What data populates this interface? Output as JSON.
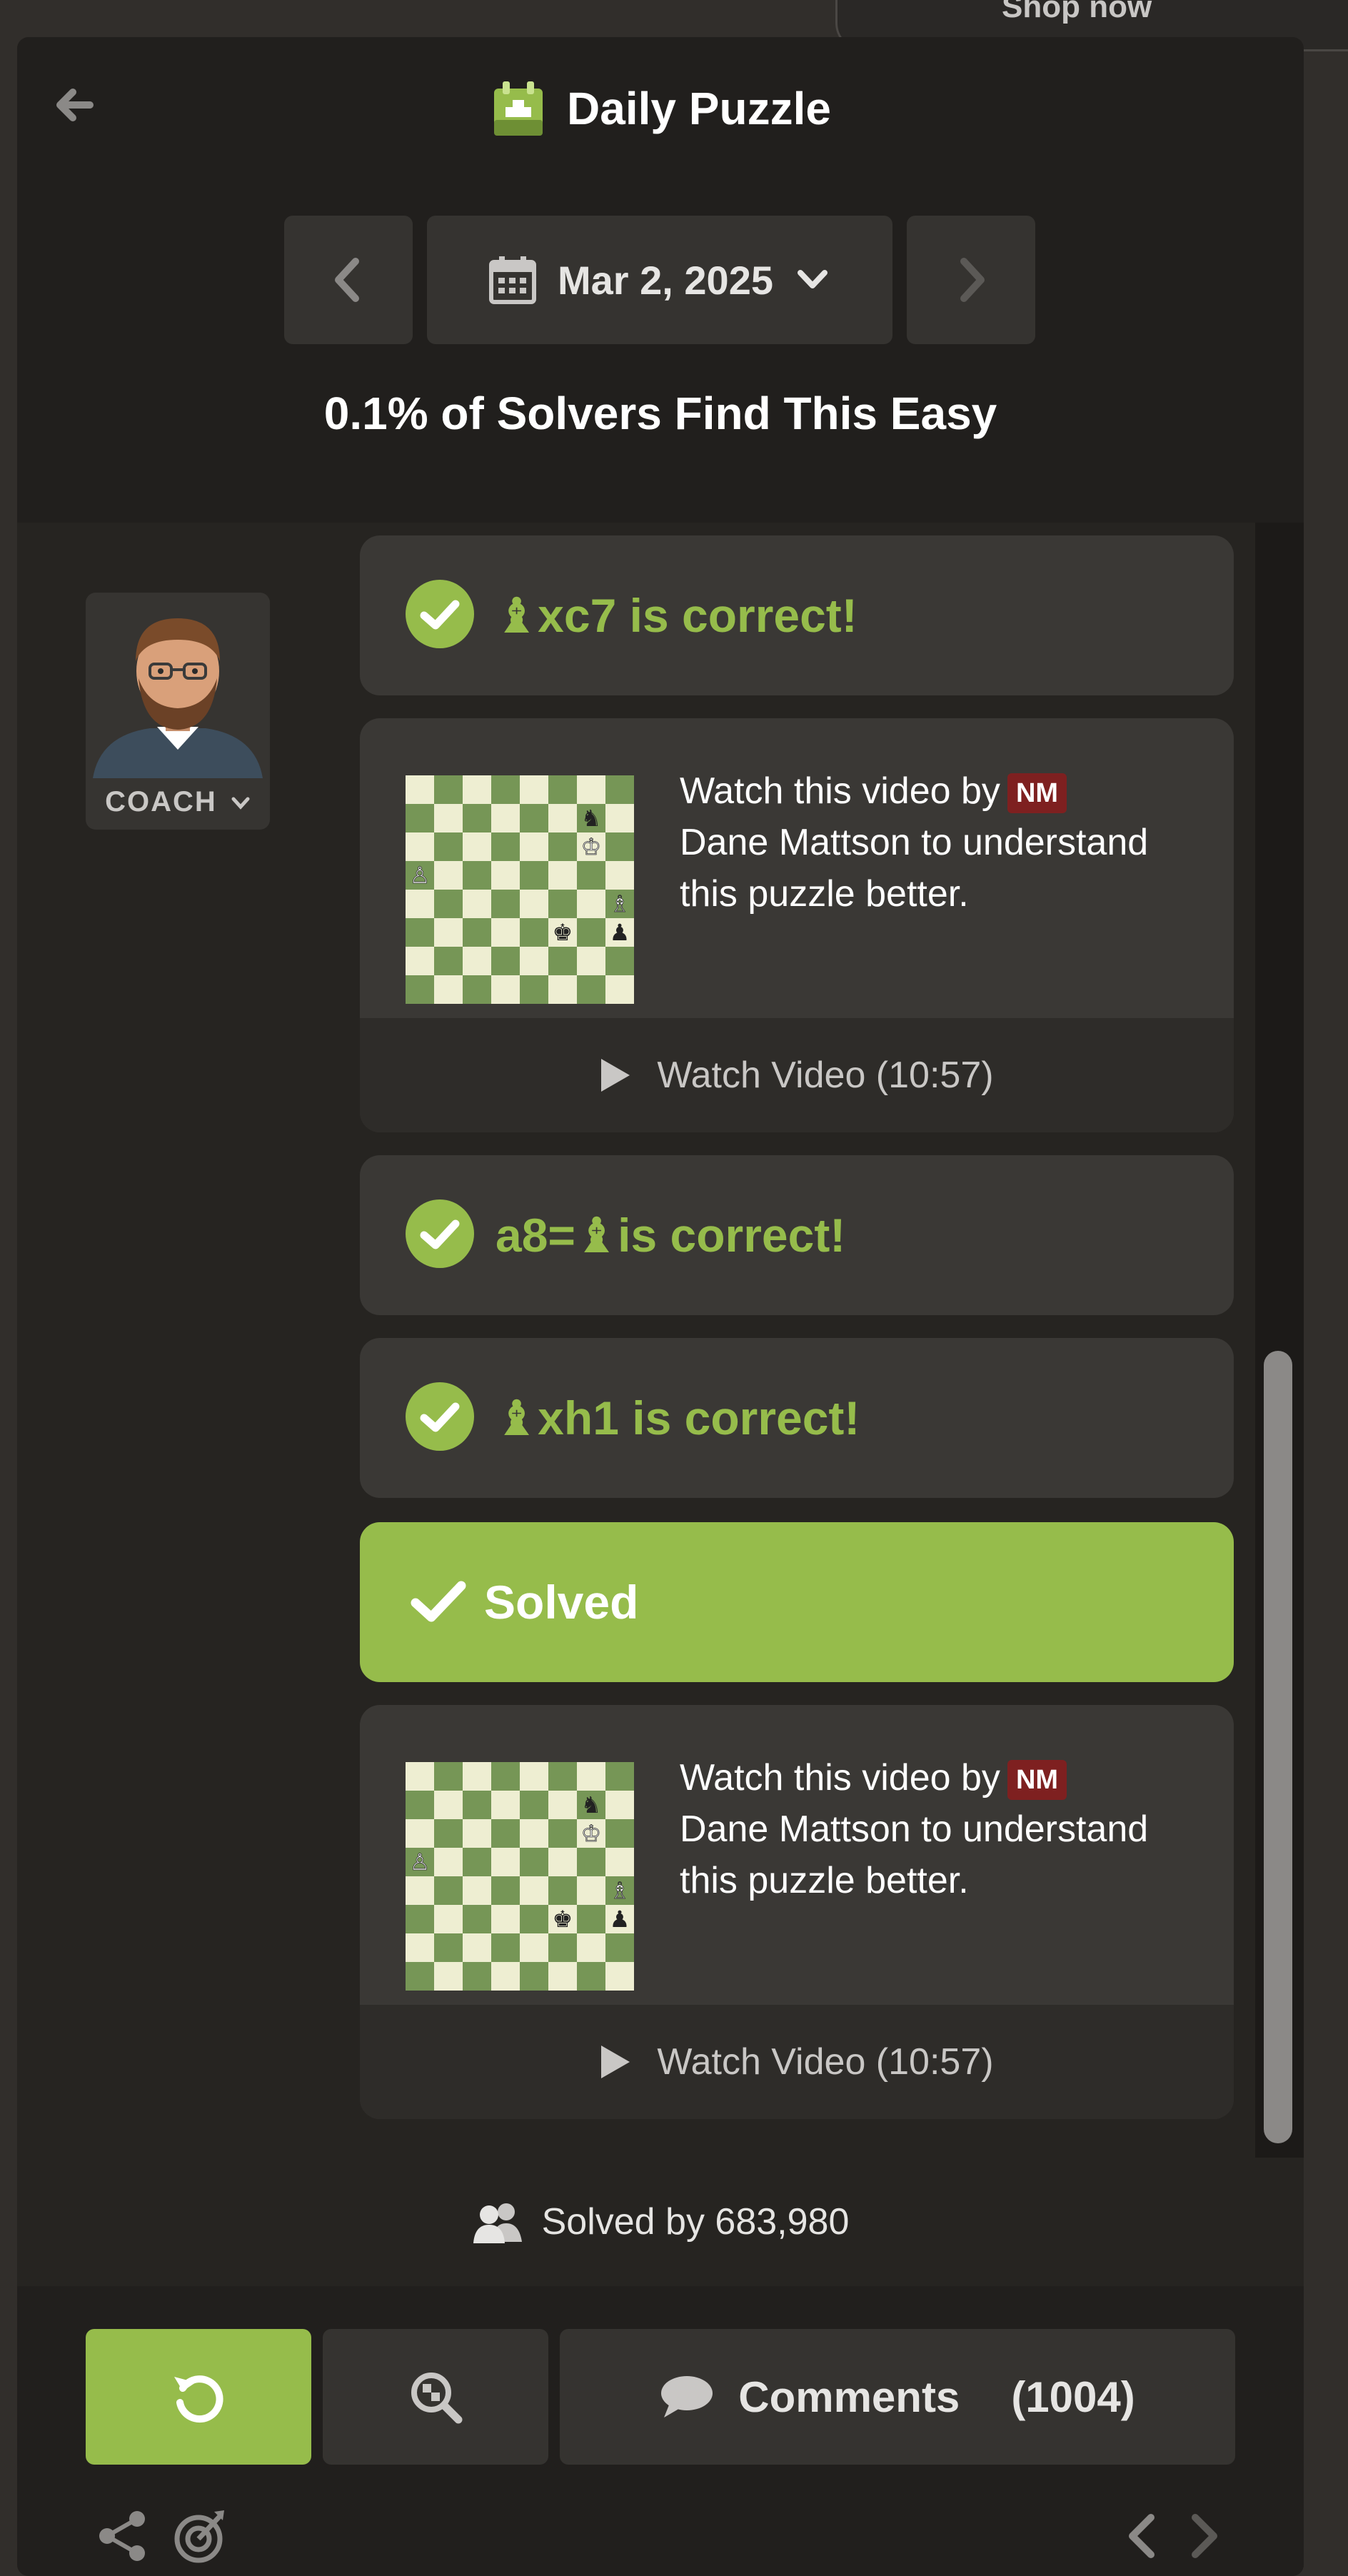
{
  "top_banner": {
    "label": "Shop now"
  },
  "header": {
    "title": "Daily Puzzle",
    "date": "Mar 2, 2025",
    "difficulty": "0.1% of Solvers Find This Easy"
  },
  "coach": {
    "label": "COACH"
  },
  "feed": {
    "moves": [
      {
        "piece": "♝",
        "text": "xc7 is correct!"
      },
      {
        "prefix": "a8=",
        "piece": "♝",
        "text": " is correct!"
      },
      {
        "piece": "♝",
        "text": "xh1 is correct!"
      }
    ],
    "video": {
      "line1": "Watch this video by",
      "badge": "NM",
      "line2": "Dane Mattson to understand this puzzle better.",
      "button": "Watch Video (10:57)"
    },
    "solved_label": "Solved"
  },
  "solved_by": "Solved by 683,980",
  "actions": {
    "comments_label": "Comments",
    "comments_count": "(1004)"
  },
  "colors": {
    "accent_green": "#96bc4b",
    "background": "#262421",
    "nm_badge": "#7e2020"
  }
}
